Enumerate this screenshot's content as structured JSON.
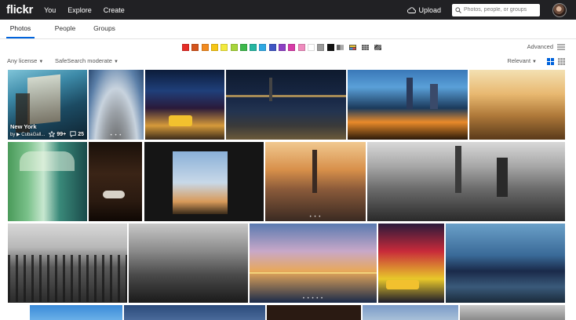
{
  "nav": {
    "logo": "flickr",
    "links": [
      "You",
      "Explore",
      "Create"
    ],
    "upload": "Upload",
    "search_placeholder": "Photos, people, or groups"
  },
  "tabs": [
    {
      "label": "Photos",
      "active": true
    },
    {
      "label": "People",
      "active": false
    },
    {
      "label": "Groups",
      "active": false
    }
  ],
  "color_filters": [
    "#e52d27",
    "#d4541c",
    "#f28b20",
    "#f6c615",
    "#f3ea3e",
    "#a7d53b",
    "#3db84b",
    "#25b6a1",
    "#2fa8e3",
    "#3e55c4",
    "#8d40c4",
    "#d83ba7",
    "#ef8cbe",
    "#ffffff",
    "#9a9a9a",
    "#111111"
  ],
  "advanced": "Advanced",
  "filters": {
    "license": "Any license",
    "safesearch": "SafeSearch moderate",
    "sort": "Relevant"
  },
  "featured": {
    "title": "New York",
    "owner": "by ▶ CubaGall...",
    "faves": "99+",
    "comments": "25"
  },
  "colors": {
    "nav_bg": "#212124",
    "accent": "#0063dc"
  }
}
